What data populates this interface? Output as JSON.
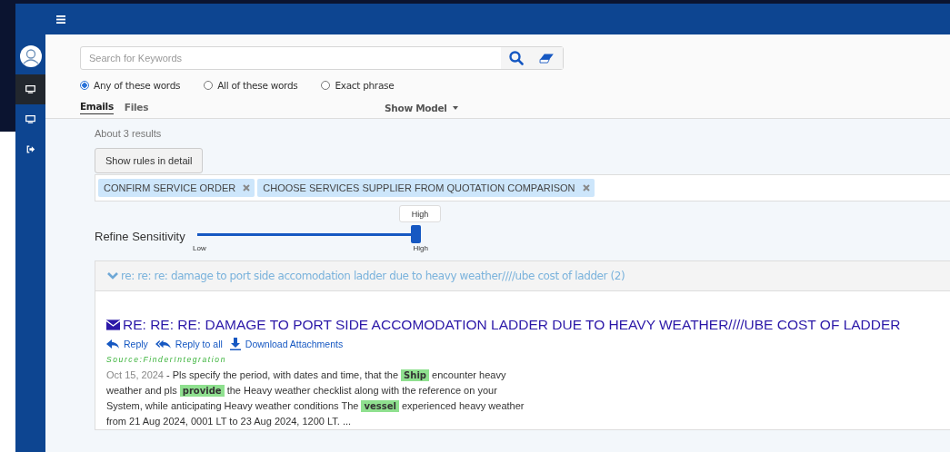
{
  "sidebar": {
    "items": [
      {
        "kind": "avatar"
      },
      {
        "kind": "monitor",
        "selected": true
      },
      {
        "kind": "monitor",
        "selected": false
      },
      {
        "kind": "sign-out",
        "selected": false
      }
    ]
  },
  "search": {
    "placeholder": "Search for Keywords"
  },
  "match_modes": [
    {
      "label": "Any of these words",
      "selected": true
    },
    {
      "label": "All of these words",
      "selected": false
    },
    {
      "label": "Exact phrase",
      "selected": false
    }
  ],
  "tabs": [
    {
      "label": "Emails",
      "selected": true
    },
    {
      "label": "Files",
      "selected": false
    }
  ],
  "show_model": "Show Model",
  "results_count": "About 3 results",
  "rules_button": "Show rules in detail",
  "rule_tags": [
    {
      "label": "CONFIRM SERVICE ORDER"
    },
    {
      "label": "CHOOSE SERVICES SUPPLIER FROM QUOTATION COMPARISON"
    }
  ],
  "sensitivity": {
    "label": "Refine Sensitivity",
    "tooltip": "High",
    "level": 1,
    "min_label": "Low",
    "max_label": "High"
  },
  "thread": {
    "expanded": true,
    "title": "re: re: re: damage to port side accomodation ladder due to heavy weather////ube cost of ladder (2)",
    "result": {
      "subject": "RE: RE: RE: DAMAGE TO PORT SIDE ACCOMODATION LADDER DUE TO HEAVY WEATHER////UBE COST OF LADDER",
      "actions": [
        {
          "kind": "reply",
          "label": "Reply"
        },
        {
          "kind": "reply-all",
          "label": "Reply to all"
        },
        {
          "kind": "download",
          "label": "Download Attachments"
        }
      ],
      "source": "Source:FinderIntegration",
      "date": "Oct 15, 2024",
      "snippet": "- Pls specify the period, with dates and time, that the **Ship** encounter heavy weather and pls **provide** the Heavy weather checklist along with the reference on your System, while anticipating Heavy weather conditions The **vessel** experienced heavy weather from 21 Aug 2024, 0001 LT to 23 Aug 2024, 1200 LT.  ..."
    }
  }
}
